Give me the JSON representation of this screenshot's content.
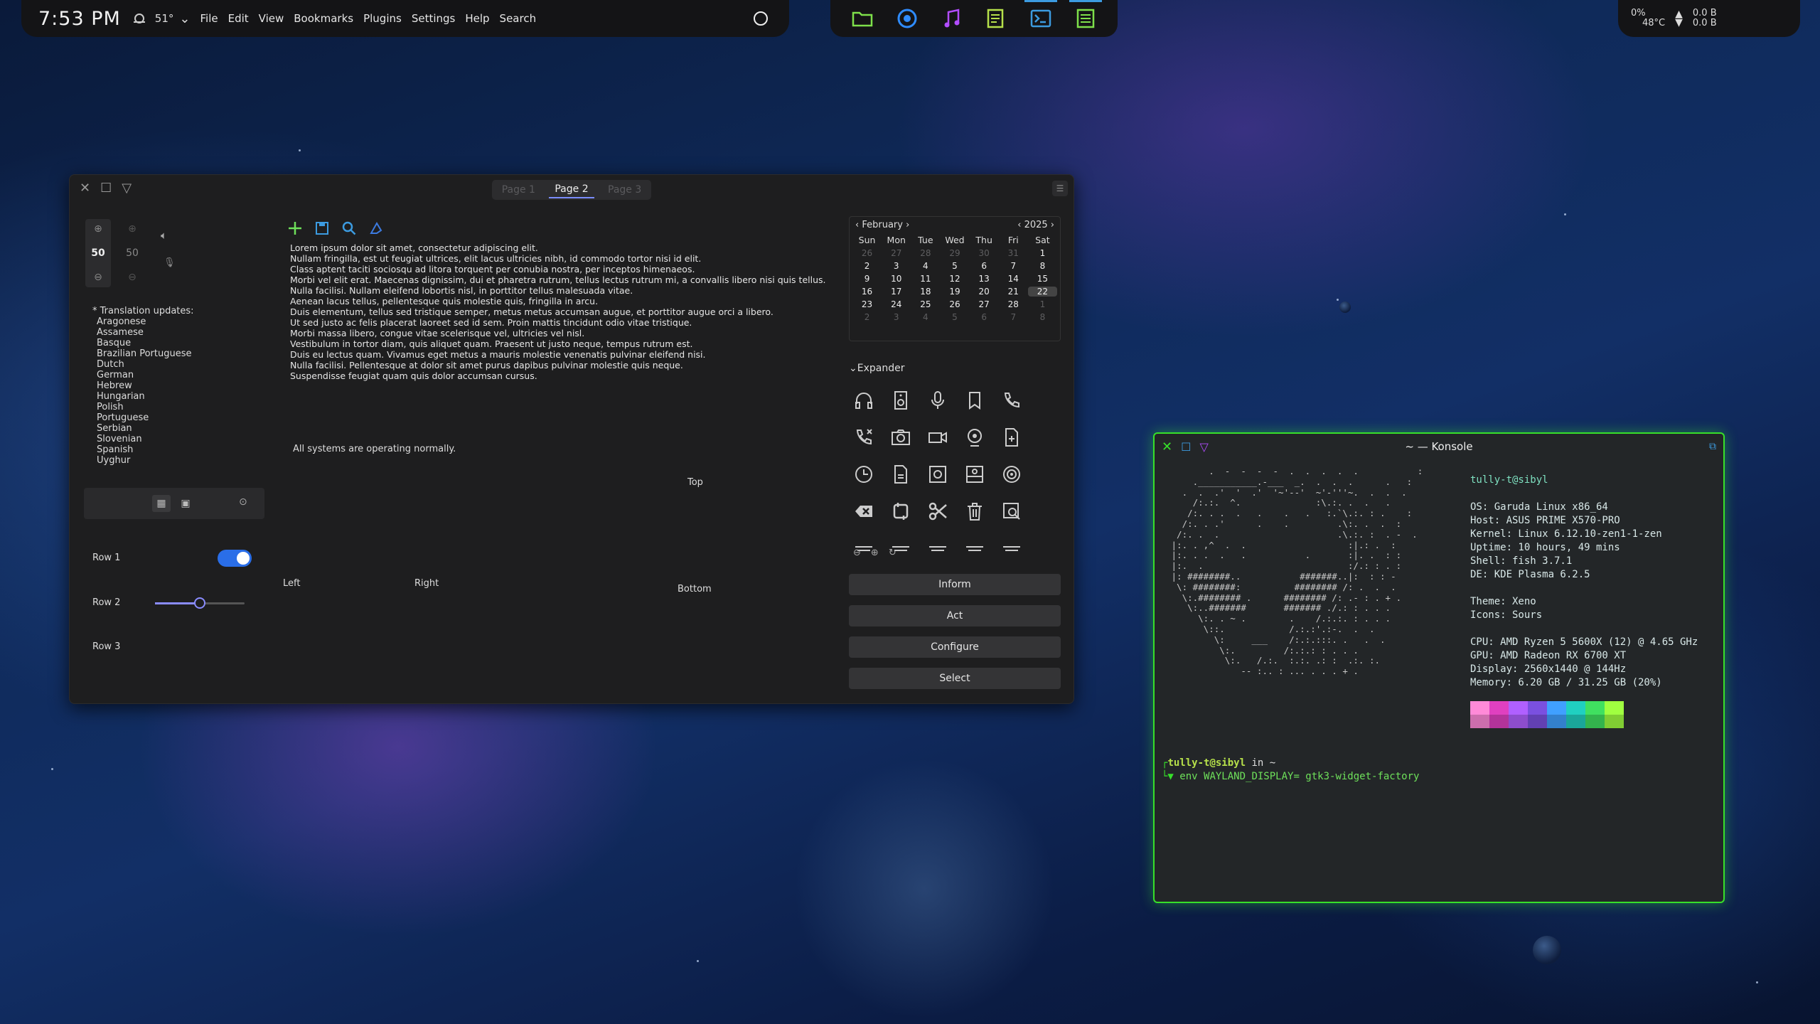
{
  "topbar": {
    "clock": "7:53 PM",
    "temperature": "51°",
    "menu": [
      "File",
      "Edit",
      "View",
      "Bookmarks",
      "Plugins",
      "Settings",
      "Help",
      "Search"
    ]
  },
  "taskbar_apps": [
    "folder-icon",
    "browser-icon",
    "music-icon",
    "notes-icon",
    "terminal-icon",
    "editor-icon"
  ],
  "tray": {
    "battery": "0%",
    "cpu_temp": "48°C",
    "net_up": "0.0 B",
    "net_down": "0.0 B"
  },
  "gtk_window": {
    "tabs": [
      "Page 1",
      "Page 2",
      "Page 3"
    ],
    "spin_values": [
      "50",
      "50"
    ],
    "translation_header": "* Translation updates:",
    "languages": [
      "Aragonese",
      "Assamese",
      "Basque",
      "Brazilian Portuguese",
      "Dutch",
      "German",
      "Hebrew",
      "Hungarian",
      "Polish",
      "Portuguese",
      "Serbian",
      "Slovenian",
      "Spanish",
      "Uyghur"
    ],
    "lorem_lines": [
      "Lorem ipsum dolor sit amet, consectetur adipiscing elit.",
      "Nullam fringilla, est ut feugiat ultrices, elit lacus ultricies nibh, id commodo tortor nisi id elit.",
      "Class aptent taciti sociosqu ad litora torquent per conubia nostra, per inceptos himenaeos.",
      "Morbi vel elit erat. Maecenas dignissim, dui et pharetra rutrum, tellus lectus rutrum mi, a convallis libero nisi quis tellus.",
      "Nulla facilisi. Nullam eleifend lobortis nisl, in porttitor tellus malesuada vitae.",
      "Aenean lacus tellus, pellentesque quis molestie quis, fringilla in arcu.",
      "Duis elementum, tellus sed tristique semper, metus metus accumsan augue, et porttitor augue orci a libero.",
      "Ut sed justo ac felis placerat laoreet sed id sem. Proin mattis tincidunt odio vitae tristique.",
      "Morbi massa libero, congue vitae scelerisque vel, ultricies vel nisl.",
      "Vestibulum in tortor diam, quis aliquet quam. Praesent ut justo neque, tempus rutrum est.",
      "Duis eu lectus quam. Vivamus eget metus a mauris molestie venenatis pulvinar eleifend nisi.",
      "Nulla facilisi. Pellentesque at dolor sit amet purus dapibus pulvinar molestie quis neque.",
      "Suspendisse feugiat quam quis dolor accumsan cursus."
    ],
    "status_message": "All systems are operating normally.",
    "rows": [
      "Row 1",
      "Row 2",
      "Row 3"
    ],
    "row2_slider_fraction": 0.5,
    "row1_toggle_on": true,
    "position_labels": {
      "top": "Top",
      "left": "Left",
      "right": "Right",
      "bottom": "Bottom"
    },
    "calendar": {
      "month": "February",
      "year": "2025",
      "weekdays": [
        "Sun",
        "Mon",
        "Tue",
        "Wed",
        "Thu",
        "Fri",
        "Sat"
      ],
      "days": [
        [
          "26",
          "27",
          "28",
          "29",
          "30",
          "31",
          "1"
        ],
        [
          "2",
          "3",
          "4",
          "5",
          "6",
          "7",
          "8"
        ],
        [
          "9",
          "10",
          "11",
          "12",
          "13",
          "14",
          "15"
        ],
        [
          "16",
          "17",
          "18",
          "19",
          "20",
          "21",
          "22"
        ],
        [
          "23",
          "24",
          "25",
          "26",
          "27",
          "28",
          "1"
        ],
        [
          "2",
          "3",
          "4",
          "5",
          "6",
          "7",
          "8"
        ]
      ],
      "today": "22"
    },
    "expander_label": "Expander",
    "action_buttons": [
      "Inform",
      "Act",
      "Configure",
      "Select"
    ]
  },
  "konsole": {
    "title": "~ — Konsole",
    "user_host": "tully-t@sibyl",
    "info": [
      "OS: Garuda Linux x86_64",
      "Host: ASUS PRIME X570-PRO",
      "Kernel: Linux 6.12.10-zen1-1-zen",
      "Uptime: 10 hours, 49 mins",
      "Shell: fish 3.7.1",
      "DE: KDE Plasma 6.2.5",
      "",
      "Theme: Xeno",
      "Icons: Sours",
      "",
      "CPU: AMD Ryzen 5 5600X (12) @ 4.65 GHz",
      "GPU: AMD Radeon RX 6700 XT",
      "Display: 2560x1440 @ 144Hz",
      "Memory: 6.20 GB / 31.25 GB (20%)"
    ],
    "palette": [
      "#ff8ad8",
      "#e040c0",
      "#b060ff",
      "#7a50e0",
      "#40a0ff",
      "#20d0c0",
      "#40e060",
      "#a0ff40"
    ],
    "prompt_user": "tully-t@sibyl",
    "prompt_suffix": " in ~",
    "command": "env WAYLAND_DISPLAY= gtk3-widget-factory",
    "accent": "#37e02a"
  }
}
